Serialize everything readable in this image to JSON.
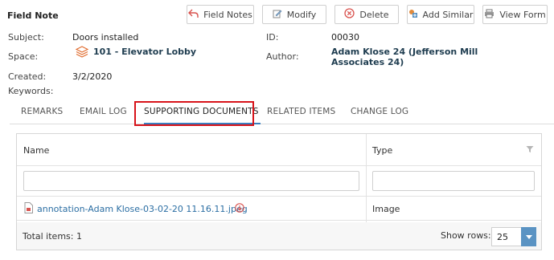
{
  "header": {
    "title": "Field Note"
  },
  "toolbar": {
    "field_notes": "Field Notes",
    "modify": "Modify",
    "delete": "Delete",
    "add_similar": "Add Similar",
    "view_form": "View Form"
  },
  "details": {
    "subject_label": "Subject:",
    "subject_value": "Doors installed",
    "space_label": "Space:",
    "space_value": "101 - Elevator Lobby",
    "created_label": "Created:",
    "created_value": "3/2/2020",
    "keywords_label": "Keywords:",
    "id_label": "ID:",
    "id_value": "00030",
    "author_label": "Author:",
    "author_value": "Adam Klose 24 (Jefferson Mill Associates 24)"
  },
  "tabs": [
    {
      "label": "REMARKS"
    },
    {
      "label": "EMAIL LOG"
    },
    {
      "label": "SUPPORTING DOCUMENTS",
      "active": true
    },
    {
      "label": "RELATED ITEMS"
    },
    {
      "label": "CHANGE LOG"
    }
  ],
  "grid": {
    "columns": [
      "Name",
      "Type"
    ],
    "rows": [
      {
        "name": "annotation-Adam Klose-03-02-20 11.16.11.jpeg",
        "type": "Image"
      }
    ],
    "footer": {
      "total": "Total items: 1",
      "show_rows_label": "Show rows:",
      "show_rows_value": "25"
    }
  },
  "colors": {
    "accent": "#3a7fbf",
    "link": "#2b6ea3",
    "delete_red": "#d9534f",
    "highlight_red": "#d8131a",
    "select_button": "#5a93c3"
  },
  "icons": {
    "field_notes": "back-arrow-icon",
    "modify": "edit-icon",
    "delete": "delete-circle-icon",
    "add_similar": "add-similar-icon",
    "view_form": "printer-icon",
    "space": "layers-icon",
    "file": "image-file-icon",
    "download": "download-circle-icon",
    "filter": "filter-icon",
    "dropdown": "caret-down-icon"
  }
}
